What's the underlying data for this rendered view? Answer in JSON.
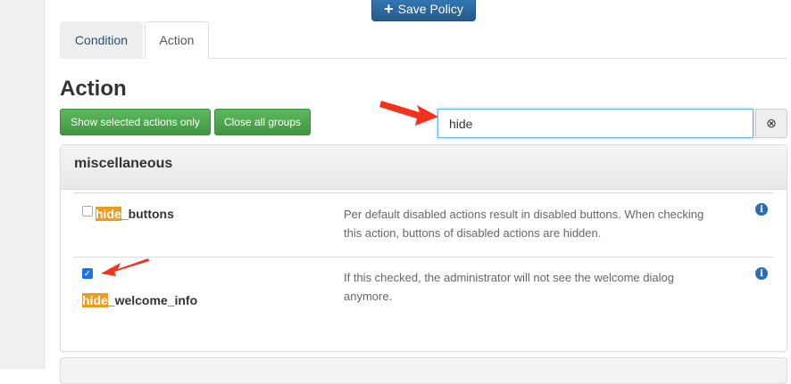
{
  "toolbar": {
    "save_label": "Save Policy"
  },
  "tabs": [
    {
      "label": "Condition",
      "active": false
    },
    {
      "label": "Action",
      "active": true
    }
  ],
  "page_title": "Action",
  "buttons": {
    "show_selected": "Show selected actions only",
    "close_groups": "Close all groups"
  },
  "search": {
    "value": "hide"
  },
  "group": {
    "title": "miscellaneous",
    "actions": [
      {
        "highlight": "hide",
        "rest": "_buttons",
        "checked": false,
        "description": "Per default disabled actions result in disabled buttons. When checking this action, buttons of disabled actions are hidden."
      },
      {
        "highlight": "hide",
        "rest": "_welcome_info",
        "checked": true,
        "description": "If this checked, the administrator will not see the welcome dialog anymore."
      }
    ]
  },
  "colors": {
    "highlight": "#ee9a1f",
    "primary": "#337ab7",
    "success": "#5cb85c",
    "annotation": "#f2321a"
  }
}
